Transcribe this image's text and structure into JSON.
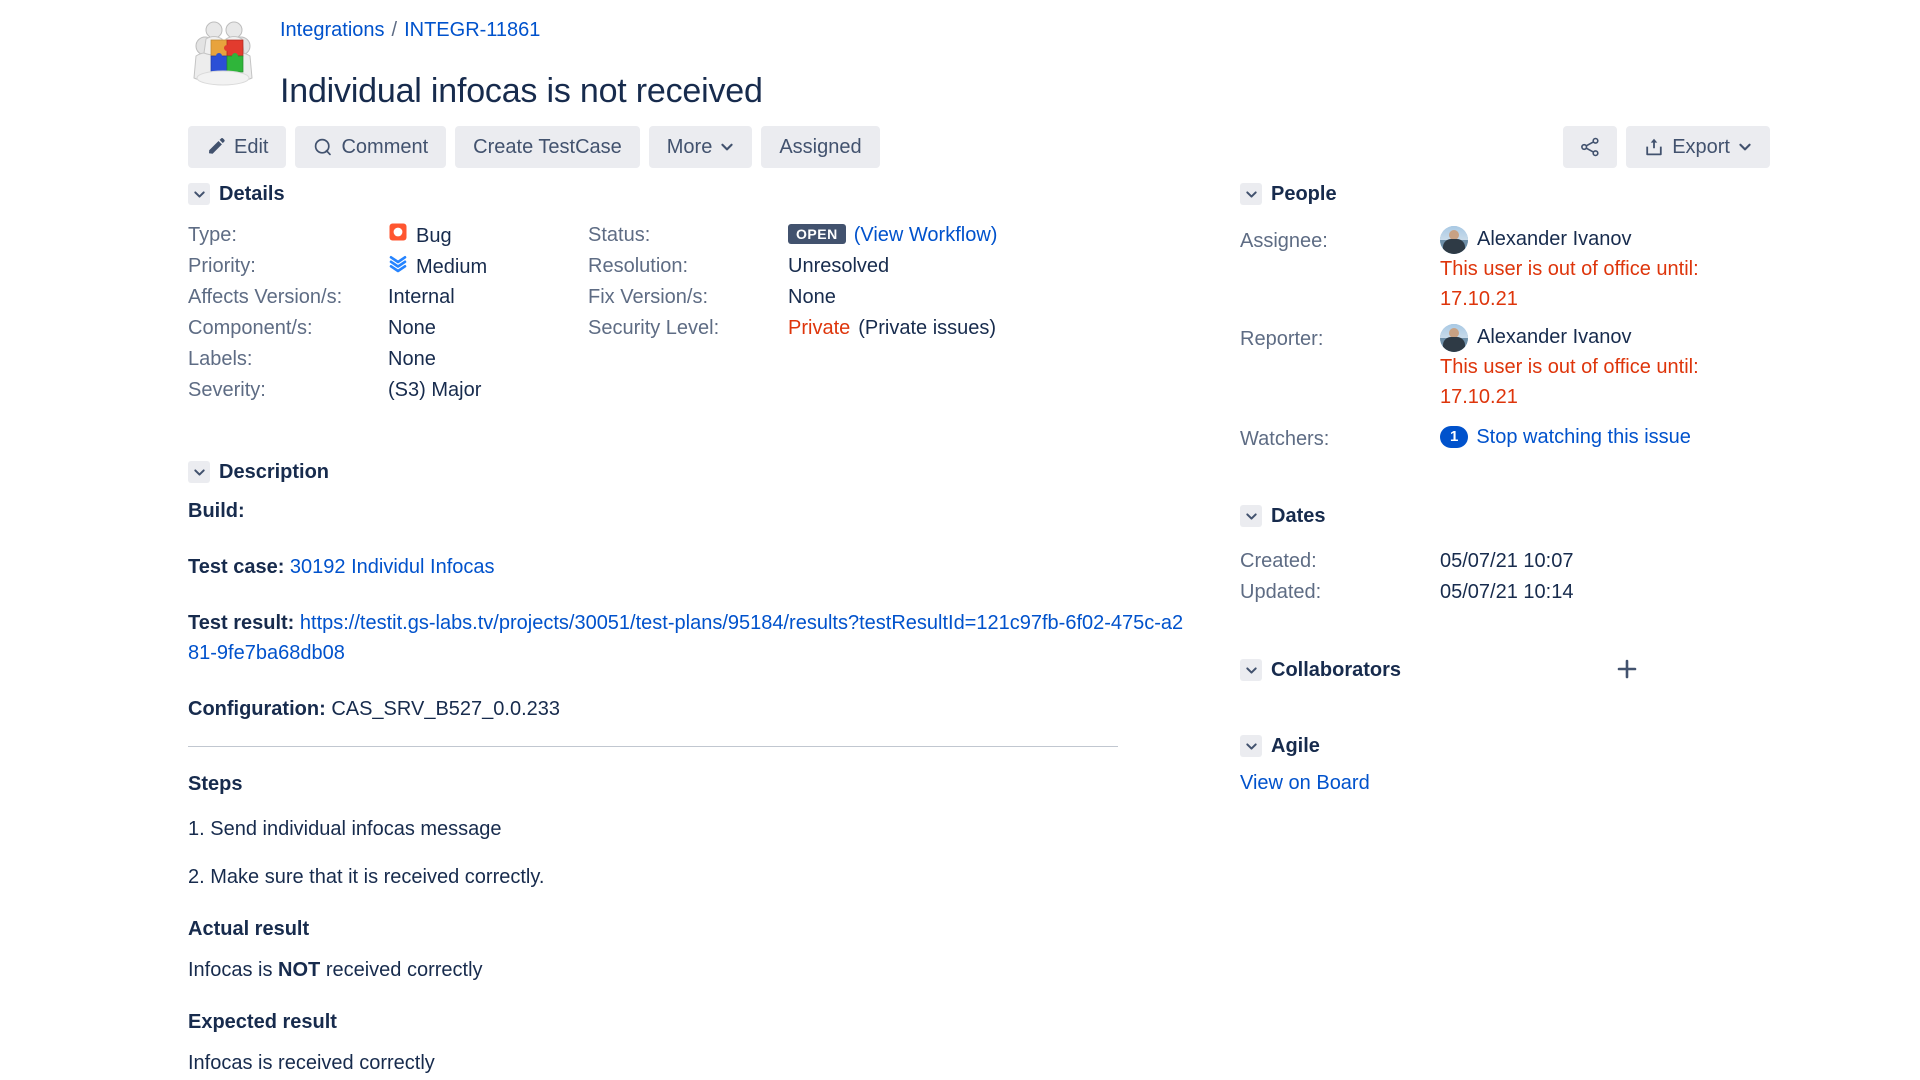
{
  "header": {
    "breadcrumb_project": "Integrations",
    "breadcrumb_sep": "/",
    "breadcrumb_issue": "INTEGR-11861",
    "title": "Individual infocas is not received",
    "project_icon": "integrations-puzzle-icon"
  },
  "toolbar": {
    "edit_label": "Edit",
    "comment_label": "Comment",
    "create_testcase_label": "Create TestCase",
    "more_label": "More",
    "assigned_label": "Assigned",
    "share_icon": "share-icon",
    "export_label": "Export",
    "edit_icon": "pencil-icon",
    "comment_icon": "comment-bubble-icon",
    "export_icon": "upload-box-icon",
    "chevron_icon": "chevron-down-icon"
  },
  "details": {
    "section_title": "Details",
    "left_fields": [
      {
        "label": "Type:",
        "value": "Bug",
        "icon": "bug-icon"
      },
      {
        "label": "Priority:",
        "value": "Medium",
        "icon": "priority-medium-icon"
      },
      {
        "label": "Affects Version/s:",
        "value": "Internal"
      },
      {
        "label": "Component/s:",
        "value": "None"
      },
      {
        "label": "Labels:",
        "value": "None"
      },
      {
        "label": "Severity:",
        "value": "(S3) Major"
      }
    ],
    "right_fields": [
      {
        "label": "Status:",
        "value": "OPEN",
        "link": "(View Workflow)"
      },
      {
        "label": "Resolution:",
        "value": "Unresolved"
      },
      {
        "label": "Fix Version/s:",
        "value": "None"
      },
      {
        "label": "Security Level:",
        "value": "Private",
        "suffix": "(Private issues)"
      }
    ]
  },
  "description": {
    "section_title": "Description",
    "build_label": "Build:",
    "testcase_label": "Test case:",
    "testcase_value": "30192 Individul Infocas",
    "testresult_label": "Test result:",
    "testresult_value": "https://testit.gs-labs.tv/projects/30051/test-plans/95184/results?testResultId=121c97fb-6f02-475c-a281-9fe7ba68db08",
    "configuration_label": "Configuration:",
    "configuration_value": "CAS_SRV_B527_0.0.233",
    "steps_heading": "Steps",
    "steps": [
      "1. Send individual infocas message",
      "2. Make sure that it is received correctly."
    ],
    "actual_heading": "Actual result",
    "actual_pre": "Infocas is ",
    "actual_bold": "NOT",
    "actual_post": " received correctly",
    "expected_heading": "Expected result",
    "expected_text": "Infocas is received correctly"
  },
  "people": {
    "section_title": "People",
    "assignee_label": "Assignee:",
    "assignee_name": "Alexander Ivanov",
    "assignee_oof": "This user is out of office until: 17.10.21",
    "reporter_label": "Reporter:",
    "reporter_name": "Alexander Ivanov",
    "reporter_oof": "This user is out of office until: 17.10.21",
    "watchers_label": "Watchers:",
    "watchers_count": "1",
    "watchers_link": "Stop watching this issue"
  },
  "dates": {
    "section_title": "Dates",
    "created_label": "Created:",
    "created_value": "05/07/21 10:07",
    "updated_label": "Updated:",
    "updated_value": "05/07/21 10:14"
  },
  "collaborators": {
    "section_title": "Collaborators",
    "add_icon": "plus-icon"
  },
  "agile": {
    "section_title": "Agile",
    "view_on_board": "View on Board"
  },
  "colors": {
    "link": "#0052CC",
    "text": "#172B4D",
    "muted": "#5E6C84",
    "danger": "#DE350B",
    "bug": "#FF5630",
    "status_bg": "#42526E",
    "button_bg": "#EBECF0"
  }
}
